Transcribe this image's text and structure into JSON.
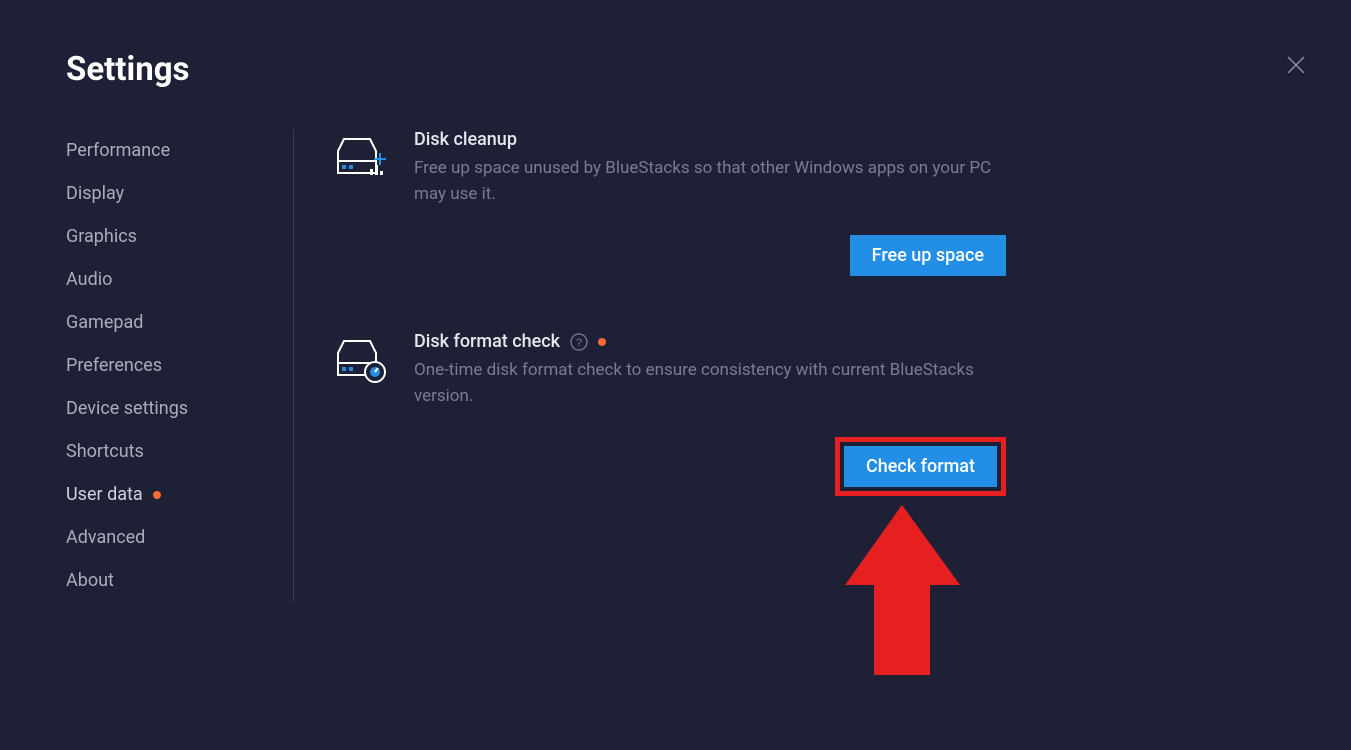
{
  "header": {
    "title": "Settings"
  },
  "sidebar": {
    "items": [
      {
        "label": "Performance",
        "has_dot": false
      },
      {
        "label": "Display",
        "has_dot": false
      },
      {
        "label": "Graphics",
        "has_dot": false
      },
      {
        "label": "Audio",
        "has_dot": false
      },
      {
        "label": "Gamepad",
        "has_dot": false
      },
      {
        "label": "Preferences",
        "has_dot": false
      },
      {
        "label": "Device settings",
        "has_dot": false
      },
      {
        "label": "Shortcuts",
        "has_dot": false
      },
      {
        "label": "User data",
        "has_dot": true
      },
      {
        "label": "Advanced",
        "has_dot": false
      },
      {
        "label": "About",
        "has_dot": false
      }
    ]
  },
  "sections": {
    "disk_cleanup": {
      "title": "Disk cleanup",
      "desc": "Free up space unused by BlueStacks so that other Windows apps on your PC may use it.",
      "button_label": "Free up space"
    },
    "disk_format": {
      "title": "Disk format check",
      "desc": "One-time disk format check to ensure consistency with current BlueStacks version.",
      "button_label": "Check format"
    }
  }
}
